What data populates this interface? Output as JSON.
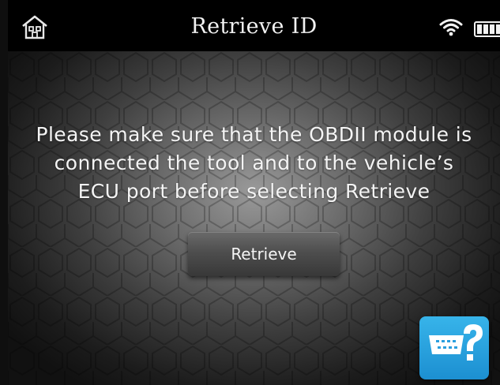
{
  "header": {
    "title": "Retrieve ID",
    "home_icon": "home-icon",
    "wifi_icon": "wifi-icon",
    "battery_icon": "battery-icon"
  },
  "main": {
    "message_lines": [
      "Please make sure that the OBDII module is",
      "connected the tool and to the vehicle’s",
      "ECU port before selecting Retrieve"
    ],
    "retrieve_label": "Retrieve",
    "help_icon": "connector-help-icon"
  },
  "colors": {
    "help_button": "#2ea6e3",
    "topbar": "#000000",
    "text": "#f4f4f4"
  }
}
